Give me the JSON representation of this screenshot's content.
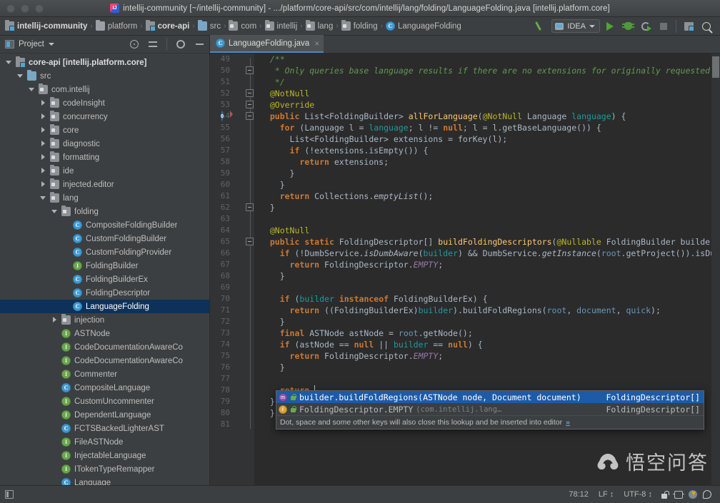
{
  "titlebar": {
    "title": "intellij-community [~/intellij-community] - .../platform/core-api/src/com/intellij/lang/folding/LanguageFolding.java [intellij.platform.core]",
    "logo_icon": "intellij-idea-logo"
  },
  "navbar": {
    "breadcrumbs": [
      {
        "label": "intellij-community",
        "icon": "module-icon",
        "bold": true
      },
      {
        "label": "platform",
        "icon": "folder-grey-icon",
        "bold": false
      },
      {
        "label": "core-api",
        "icon": "module-icon",
        "bold": true
      },
      {
        "label": "src",
        "icon": "folder-blue-icon",
        "bold": false
      },
      {
        "label": "com",
        "icon": "package-icon",
        "bold": false
      },
      {
        "label": "intellij",
        "icon": "package-icon",
        "bold": false
      },
      {
        "label": "lang",
        "icon": "package-icon",
        "bold": false
      },
      {
        "label": "folding",
        "icon": "package-icon",
        "bold": false
      },
      {
        "label": "LanguageFolding",
        "icon": "class-icon",
        "bold": false
      }
    ],
    "separator": "›",
    "run_config": "IDEA",
    "buttons": [
      "build-hammer-icon",
      "run-button",
      "debug-button",
      "coverage-button",
      "stop-button",
      "project-structure-icon",
      "search-icon"
    ]
  },
  "project_panel": {
    "title": "Project",
    "header_buttons": [
      "locate-target-icon",
      "collapse-all-icon",
      "settings-gear-icon",
      "minimize-icon"
    ],
    "tree": [
      {
        "label": "core-api [intellij.platform.core]",
        "indent": 0,
        "arrow": "open",
        "icon": "module-icon",
        "bold": true
      },
      {
        "label": "src",
        "indent": 1,
        "arrow": "open",
        "icon": "folder-blue-icon",
        "bold": false
      },
      {
        "label": "com.intellij",
        "indent": 2,
        "arrow": "open",
        "icon": "package-icon",
        "bold": false
      },
      {
        "label": "codeInsight",
        "indent": 3,
        "arrow": "closed",
        "icon": "package-icon",
        "bold": false
      },
      {
        "label": "concurrency",
        "indent": 3,
        "arrow": "closed",
        "icon": "package-icon",
        "bold": false
      },
      {
        "label": "core",
        "indent": 3,
        "arrow": "closed",
        "icon": "package-icon",
        "bold": false
      },
      {
        "label": "diagnostic",
        "indent": 3,
        "arrow": "closed",
        "icon": "package-icon",
        "bold": false
      },
      {
        "label": "formatting",
        "indent": 3,
        "arrow": "closed",
        "icon": "package-icon",
        "bold": false
      },
      {
        "label": "ide",
        "indent": 3,
        "arrow": "closed",
        "icon": "package-icon",
        "bold": false
      },
      {
        "label": "injected.editor",
        "indent": 3,
        "arrow": "closed",
        "icon": "package-icon",
        "bold": false
      },
      {
        "label": "lang",
        "indent": 3,
        "arrow": "open",
        "icon": "package-icon",
        "bold": false
      },
      {
        "label": "folding",
        "indent": 4,
        "arrow": "open",
        "icon": "package-icon",
        "bold": false
      },
      {
        "label": "CompositeFoldingBuilder",
        "indent": 5,
        "arrow": "none",
        "icon": "class-icon",
        "bold": false
      },
      {
        "label": "CustomFoldingBuilder",
        "indent": 5,
        "arrow": "none",
        "icon": "class-icon",
        "bold": false
      },
      {
        "label": "CustomFoldingProvider",
        "indent": 5,
        "arrow": "none",
        "icon": "class-icon",
        "bold": false
      },
      {
        "label": "FoldingBuilder",
        "indent": 5,
        "arrow": "none",
        "icon": "interface-icon",
        "bold": false
      },
      {
        "label": "FoldingBuilderEx",
        "indent": 5,
        "arrow": "none",
        "icon": "class-icon",
        "bold": false
      },
      {
        "label": "FoldingDescriptor",
        "indent": 5,
        "arrow": "none",
        "icon": "class-icon",
        "bold": false
      },
      {
        "label": "LanguageFolding",
        "indent": 5,
        "arrow": "none",
        "icon": "class-icon",
        "bold": false,
        "selected": true
      },
      {
        "label": "injection",
        "indent": 4,
        "arrow": "closed",
        "icon": "package-icon",
        "bold": false
      },
      {
        "label": "ASTNode",
        "indent": 4,
        "arrow": "none",
        "icon": "interface-icon",
        "bold": false
      },
      {
        "label": "CodeDocumentationAwareCo",
        "indent": 4,
        "arrow": "none",
        "icon": "interface-icon",
        "bold": false
      },
      {
        "label": "CodeDocumentationAwareCo",
        "indent": 4,
        "arrow": "none",
        "icon": "interface-icon",
        "bold": false
      },
      {
        "label": "Commenter",
        "indent": 4,
        "arrow": "none",
        "icon": "interface-icon",
        "bold": false
      },
      {
        "label": "CompositeLanguage",
        "indent": 4,
        "arrow": "none",
        "icon": "class-icon",
        "bold": false
      },
      {
        "label": "CustomUncommenter",
        "indent": 4,
        "arrow": "none",
        "icon": "interface-icon",
        "bold": false
      },
      {
        "label": "DependentLanguage",
        "indent": 4,
        "arrow": "none",
        "icon": "interface-icon",
        "bold": false
      },
      {
        "label": "FCTSBackedLighterAST",
        "indent": 4,
        "arrow": "none",
        "icon": "class-icon",
        "bold": false
      },
      {
        "label": "FileASTNode",
        "indent": 4,
        "arrow": "none",
        "icon": "interface-icon",
        "bold": false
      },
      {
        "label": "InjectableLanguage",
        "indent": 4,
        "arrow": "none",
        "icon": "interface-icon",
        "bold": false
      },
      {
        "label": "ITokenTypeRemapper",
        "indent": 4,
        "arrow": "none",
        "icon": "interface-icon",
        "bold": false
      },
      {
        "label": "Language",
        "indent": 4,
        "arrow": "none",
        "icon": "class-icon",
        "bold": false
      }
    ]
  },
  "editor": {
    "tab": {
      "label": "LanguageFolding.java",
      "icon": "class-icon",
      "close": "×"
    },
    "first_line": 49,
    "lines": [
      {
        "n": 49,
        "html": "  <span class=\"cmt\">/**</span>"
      },
      {
        "n": 50,
        "html": "   <span class=\"cmt\">* Only queries base language results if there are no extensions for originally requested</span>"
      },
      {
        "n": 51,
        "html": "   <span class=\"cmt\">*/</span>"
      },
      {
        "n": 52,
        "html": "  <span class=\"ann\">@NotNull</span>"
      },
      {
        "n": 53,
        "html": "  <span class=\"ann\">@Override</span>"
      },
      {
        "n": 54,
        "html": "  <span class=\"kw\">public</span> List&lt;FoldingBuilder&gt; <span class=\"mth\">allForLanguage</span>(<span class=\"ann\">@NotNull</span> Language <span class=\"par\">language</span>) {"
      },
      {
        "n": 55,
        "html": "    <span class=\"kw\">for</span> (Language l = <span class=\"par\">language</span>; l != <span class=\"kw\">null</span>; l = l.getBaseLanguage()) {"
      },
      {
        "n": 56,
        "html": "      List&lt;FoldingBuilder&gt; extensions = forKey(l);"
      },
      {
        "n": 57,
        "html": "      <span class=\"kw\">if</span> (!extensions.isEmpty()) {"
      },
      {
        "n": 58,
        "html": "        <span class=\"kw\">return</span> extensions;"
      },
      {
        "n": 59,
        "html": "      }"
      },
      {
        "n": 60,
        "html": "    }"
      },
      {
        "n": 61,
        "html": "    <span class=\"kw\">return</span> Collections.<span class=\"itl\">emptyList</span>();"
      },
      {
        "n": 62,
        "html": "  }"
      },
      {
        "n": 63,
        "html": ""
      },
      {
        "n": 64,
        "html": "  <span class=\"ann\">@NotNull</span>"
      },
      {
        "n": 65,
        "html": "  <span class=\"kw\">public static</span> FoldingDescriptor[] <span class=\"mth\">buildFoldingDescriptors</span>(<span class=\"ann\">@Nullable</span> FoldingBuilder builder"
      },
      {
        "n": 66,
        "html": "    <span class=\"kw\">if</span> (!DumbService.<span class=\"itl\">isDumbAware</span>(<span class=\"par\">builder</span>) &amp;&amp; DumbService.<span class=\"itl\">getInstance</span>(<span class=\"num\">root</span>.getProject()).isDum"
      },
      {
        "n": 67,
        "html": "      <span class=\"kw\">return</span> FoldingDescriptor.<span class=\"fitl\">EMPTY</span>;"
      },
      {
        "n": 68,
        "html": "    }"
      },
      {
        "n": 69,
        "html": ""
      },
      {
        "n": 70,
        "html": "    <span class=\"kw\">if</span> (<span class=\"par\">builder</span> <span class=\"kw\">instanceof</span> FoldingBuilderEx) {"
      },
      {
        "n": 71,
        "html": "      <span class=\"kw\">return</span> ((FoldingBuilderEx)<span class=\"par\">builder</span>).buildFoldRegions(<span class=\"num\">root</span>, <span class=\"num\">document</span>, <span class=\"num\">quick</span>);"
      },
      {
        "n": 72,
        "html": "    }"
      },
      {
        "n": 73,
        "html": "    <span class=\"kw\">final</span> ASTNode astNode = <span class=\"num\">root</span>.getNode();"
      },
      {
        "n": 74,
        "html": "    <span class=\"kw\">if</span> (astNode == <span class=\"kw\">null</span> || <span class=\"par\">builder</span> == <span class=\"kw\">null</span>) {"
      },
      {
        "n": 75,
        "html": "      <span class=\"kw\">return</span> FoldingDescriptor.<span class=\"fitl\">EMPTY</span>;"
      },
      {
        "n": 76,
        "html": "    }"
      },
      {
        "n": 77,
        "html": ""
      },
      {
        "n": 78,
        "html": "    <span class=\"kw\">return</span> <span class=\"caret\"></span>"
      },
      {
        "n": 79,
        "html": "  }"
      },
      {
        "n": 80,
        "html": "  }"
      },
      {
        "n": 81,
        "html": ""
      }
    ]
  },
  "autocomplete": {
    "items": [
      {
        "name": "builder.buildFoldRegions(ASTNode node, Document document)",
        "package": "",
        "type": "FoldingDescriptor[]",
        "kind_icon": "method-icon",
        "access_icon": "lock-icon",
        "selected": true
      },
      {
        "name": "FoldingDescriptor.EMPTY",
        "package": "(com.intellij.lang…",
        "type": "FoldingDescriptor[]",
        "kind_icon": "field-icon",
        "access_icon": "lock-icon",
        "selected": false
      }
    ],
    "hint": "Dot, space and some other keys will also close this lookup and be inserted into editor",
    "hint_more": "»"
  },
  "statusbar": {
    "position": "78:12",
    "line_separator": "LF",
    "encoding": "UTF-8",
    "arrows": "↕",
    "icons": [
      "toggle-sidebar-icon",
      "lock-icon",
      "memory-indicator-icon",
      "background-tasks-icon",
      "notifications-icon"
    ]
  },
  "watermark": {
    "text": "悟空问答"
  },
  "colors": {
    "editor_bg": "#2b2b2b",
    "panel_bg": "#3c3f41",
    "gutter_bg": "#313335",
    "selection_blue": "#0d3159",
    "lookup_selection": "#1d5ba6",
    "tab_active_underline": "#4a88c7"
  }
}
